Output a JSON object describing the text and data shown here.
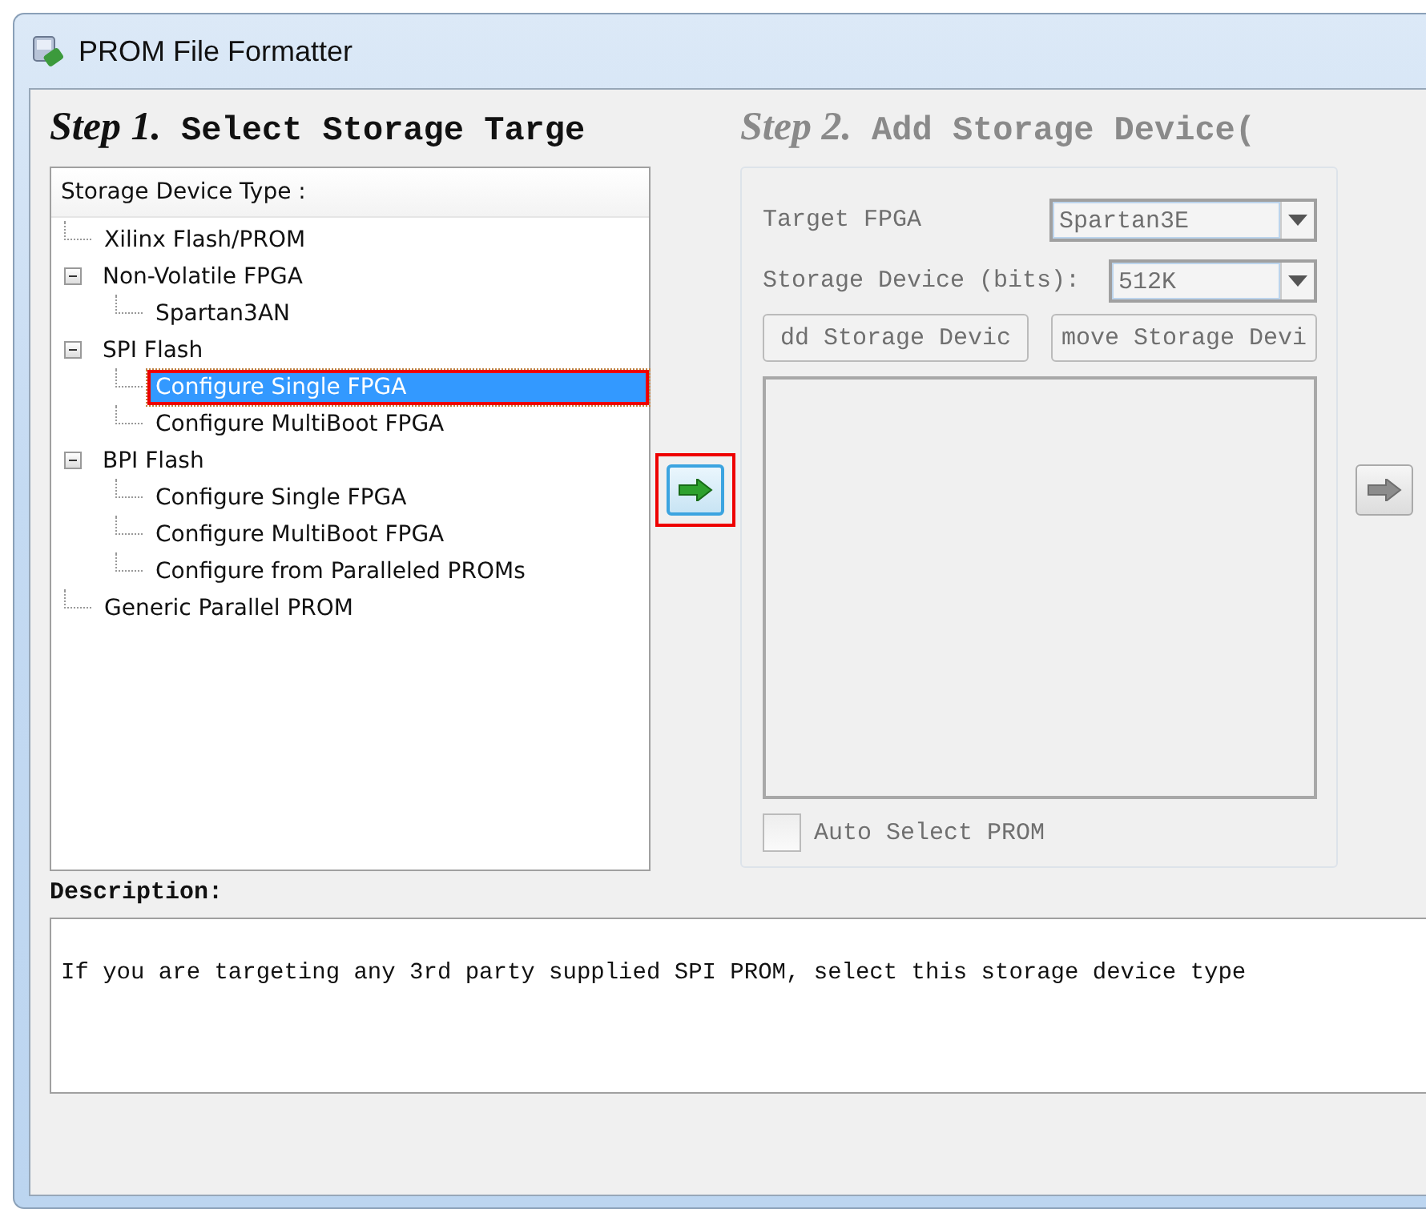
{
  "window": {
    "title": "PROM File Formatter"
  },
  "step1": {
    "step": "Step 1.",
    "title": "Select Storage Targe",
    "tree_header": "Storage Device Type :",
    "tree": [
      {
        "label": "Xilinx Flash/PROM",
        "selected": false,
        "highlighted": false
      },
      {
        "label": "Non-Volatile FPGA",
        "expanded": true,
        "selected": false,
        "highlighted": false,
        "children": [
          {
            "label": "Spartan3AN",
            "selected": false,
            "highlighted": false
          }
        ]
      },
      {
        "label": "SPI Flash",
        "expanded": true,
        "selected": false,
        "highlighted": false,
        "children": [
          {
            "label": "Configure Single FPGA",
            "selected": true,
            "highlighted": true
          },
          {
            "label": "Configure MultiBoot FPGA",
            "selected": false,
            "highlighted": false
          }
        ]
      },
      {
        "label": "BPI Flash",
        "expanded": true,
        "selected": false,
        "highlighted": false,
        "children": [
          {
            "label": "Configure Single FPGA",
            "selected": false,
            "highlighted": false
          },
          {
            "label": "Configure MultiBoot FPGA",
            "selected": false,
            "highlighted": false
          },
          {
            "label": "Configure from Paralleled PROMs",
            "selected": false,
            "highlighted": false
          }
        ]
      },
      {
        "label": "Generic Parallel PROM",
        "selected": false,
        "highlighted": false
      }
    ]
  },
  "next_button_1": {
    "disabled": false,
    "highlighted": true
  },
  "step2": {
    "step": "Step 2.",
    "title": "Add Storage Device(",
    "disabled": true,
    "target_fpga": {
      "label": "Target FPGA",
      "value": "Spartan3E"
    },
    "storage_device": {
      "label": "Storage Device (bits):",
      "value": "512K"
    },
    "buttons": [
      "dd Storage Devic",
      "move Storage Devi"
    ],
    "auto_select": {
      "label": "Auto Select PROM",
      "checked": false
    }
  },
  "next_button_2": {
    "disabled": true,
    "highlighted": false
  },
  "description": {
    "label": "Description:",
    "text": "If you are targeting any 3rd party supplied SPI PROM, select this storage device type"
  }
}
